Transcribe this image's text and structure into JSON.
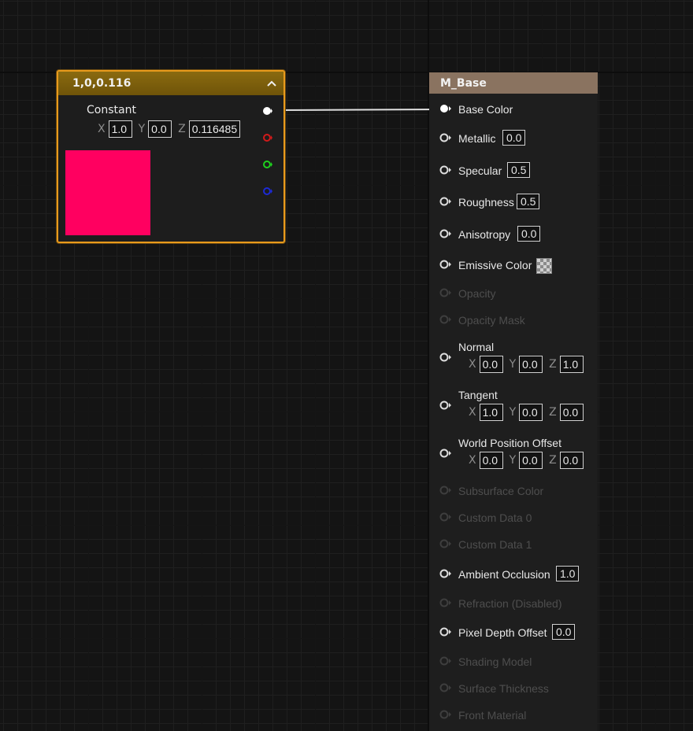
{
  "constant_node": {
    "title": "1,0,0.116",
    "label": "Constant",
    "x_label": "X",
    "x_value": "1.0",
    "y_label": "Y",
    "y_value": "0.0",
    "z_label": "Z",
    "z_value": "0.116485",
    "swatch_color": "#ff0060",
    "accent_color": "#e89a1c",
    "outputs": [
      "rgb-output",
      "red-output",
      "green-output",
      "blue-output"
    ]
  },
  "material_node": {
    "title": "M_Base",
    "header_color": "#8a7360",
    "base_color": "Base Color",
    "metallic": "Metallic",
    "metallic_value": "0.0",
    "specular": "Specular",
    "specular_value": "0.5",
    "roughness": "Roughness",
    "roughness_value": "0.5",
    "anisotropy": "Anisotropy",
    "anisotropy_value": "0.0",
    "emissive": "Emissive Color",
    "opacity": "Opacity",
    "opacity_mask": "Opacity Mask",
    "normal": "Normal",
    "normal_x": "0.0",
    "normal_y": "0.0",
    "normal_z": "1.0",
    "tangent": "Tangent",
    "tangent_x": "1.0",
    "tangent_y": "0.0",
    "tangent_z": "0.0",
    "wpo": "World Position Offset",
    "wpo_x": "0.0",
    "wpo_y": "0.0",
    "wpo_z": "0.0",
    "subsurface": "Subsurface Color",
    "custom0": "Custom Data 0",
    "custom1": "Custom Data 1",
    "ao": "Ambient Occlusion",
    "ao_value": "1.0",
    "refraction": "Refraction (Disabled)",
    "pdo": "Pixel Depth Offset",
    "pdo_value": "0.0",
    "shading_model": "Shading Model",
    "surface_thickness": "Surface Thickness",
    "front_material": "Front Material",
    "axis_x": "X",
    "axis_y": "Y",
    "axis_z": "Z"
  }
}
